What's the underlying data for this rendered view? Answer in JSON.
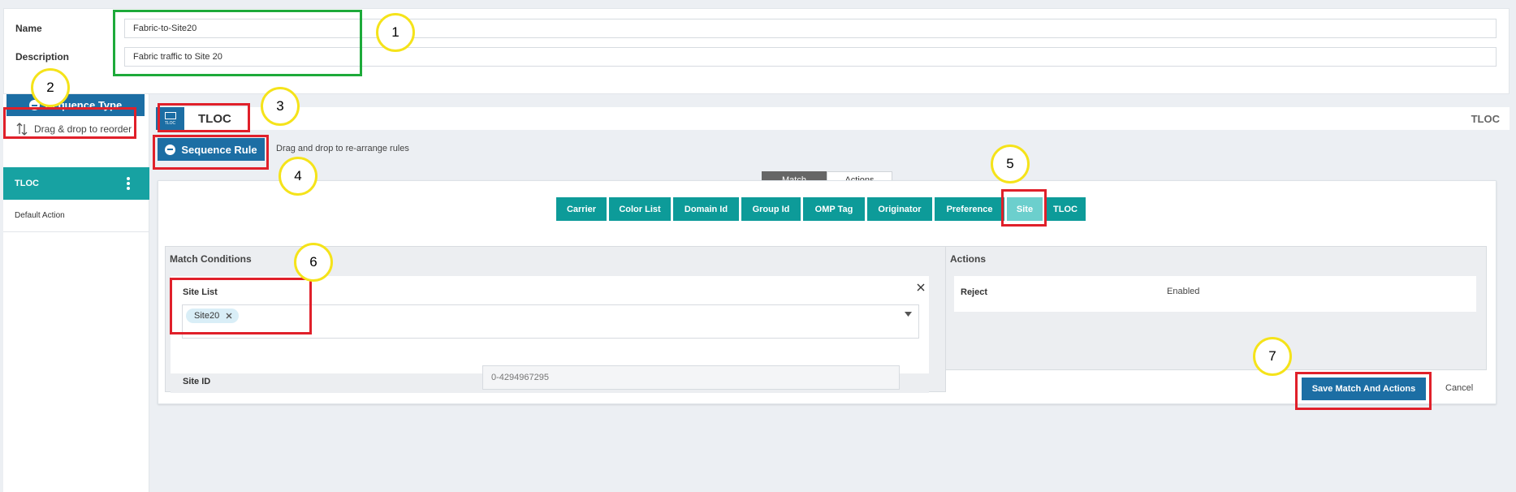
{
  "form": {
    "name_label": "Name",
    "name_value": "Fabric-to-Site20",
    "description_label": "Description",
    "description_value": "Fabric traffic to Site 20"
  },
  "sidebar": {
    "sequence_type_label": "Sequence Type",
    "drag_reorder_label": "Drag & drop to reorder",
    "items": [
      {
        "label": "TLOC"
      },
      {
        "label": "Default Action"
      }
    ]
  },
  "sequence": {
    "title": "TLOC",
    "icon_label": "TLOC",
    "right_label": "TLOC",
    "sequence_rule_label": "Sequence Rule",
    "drag_rules_label": "Drag and drop to re-arrange rules"
  },
  "tabs": [
    "Match",
    "Actions"
  ],
  "match_buttons": [
    "Carrier",
    "Color List",
    "Domain Id",
    "Group Id",
    "OMP Tag",
    "Originator",
    "Preference",
    "Site",
    "TLOC"
  ],
  "match_conditions": {
    "title": "Match Conditions",
    "site_list_label": "Site List",
    "site_list_chip": "Site20",
    "site_id_label": "Site ID",
    "site_id_placeholder": "0-4294967295"
  },
  "actions": {
    "title": "Actions",
    "rows": [
      {
        "label": "Reject",
        "value": "Enabled"
      }
    ]
  },
  "footer": {
    "save_label": "Save Match And Actions",
    "cancel_label": "Cancel"
  },
  "annotations": [
    "1",
    "2",
    "3",
    "4",
    "5",
    "6",
    "7"
  ],
  "colors": {
    "primary_blue": "#1c6ea4",
    "teal": "#0d9b99",
    "teal_active": "#6ccfcd",
    "annotation_yellow": "#f5e31a",
    "annotation_red": "#e0202a",
    "annotation_green": "#1daa3a"
  }
}
